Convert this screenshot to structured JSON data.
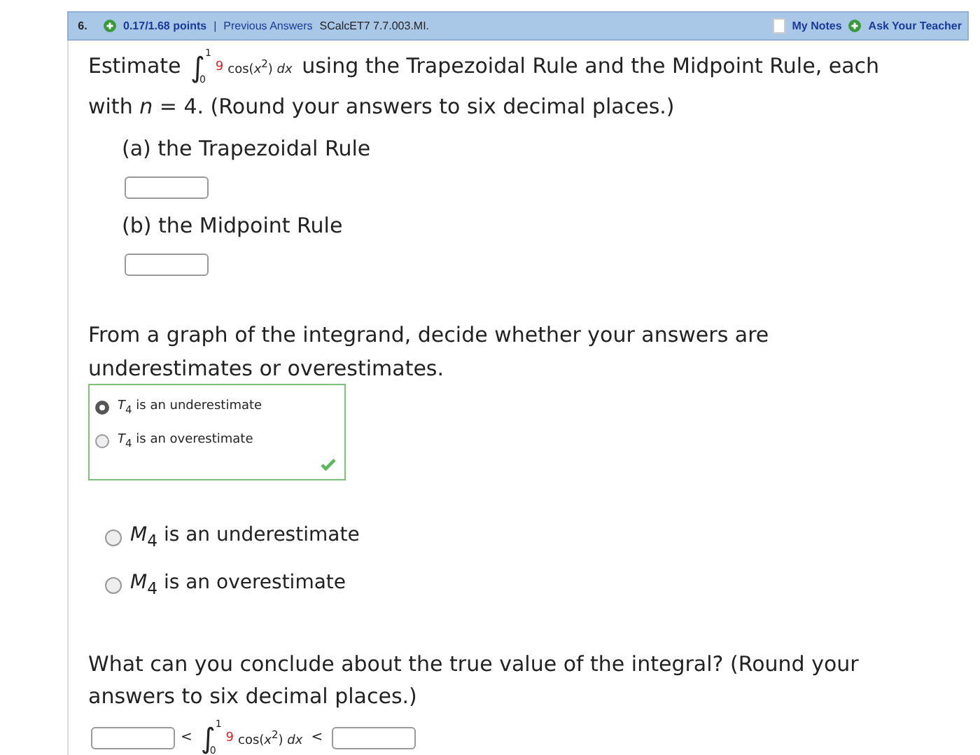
{
  "header": {
    "number": "6.",
    "points": "0.17/1.68 points",
    "separator": "|",
    "previous": "Previous Answers",
    "code": "SCalcET7 7.7.003.MI.",
    "notes": "My Notes",
    "ask": "Ask Your Teacher"
  },
  "intro": {
    "before": "Estimate",
    "integral": {
      "sign": "∫",
      "upper": "1",
      "lower": "0",
      "coefficient": "9",
      "integrand": "cos(*x*$^{2}$) *dx*"
    },
    "after": "using the Trapezoidal Rule and the Midpoint Rule, each with *n* = 4. (Round your answers to six decimal places.)"
  },
  "parts": [
    {
      "label": "(a) the Trapezoidal Rule"
    },
    {
      "label": "(b) the Midpoint Rule"
    }
  ],
  "question": "From a graph of the integrand, decide whether your answers are underestimates or overestimates.",
  "choice_groups": [
    {
      "correct": true,
      "options": [
        {
          "label": "*T*$_{4}$ is an underestimate",
          "selected": true
        },
        {
          "label": "*T*$_{4}$ is an overestimate",
          "selected": false
        }
      ]
    },
    {
      "correct": false,
      "options": [
        {
          "label": "*M*$_{4}$ is an underestimate",
          "selected": false
        },
        {
          "label": "*M*$_{4}$ is an overestimate",
          "selected": false
        }
      ]
    }
  ],
  "conclusion": "What can you conclude about the true value of the integral? (Round your answers to six decimal places.)",
  "bounds": {
    "less": "<",
    "integral": {
      "sign": "∫",
      "upper": "1",
      "lower": "0",
      "coefficient": "9",
      "integrand": "cos(*x*$^{2}$) *dx*"
    }
  }
}
